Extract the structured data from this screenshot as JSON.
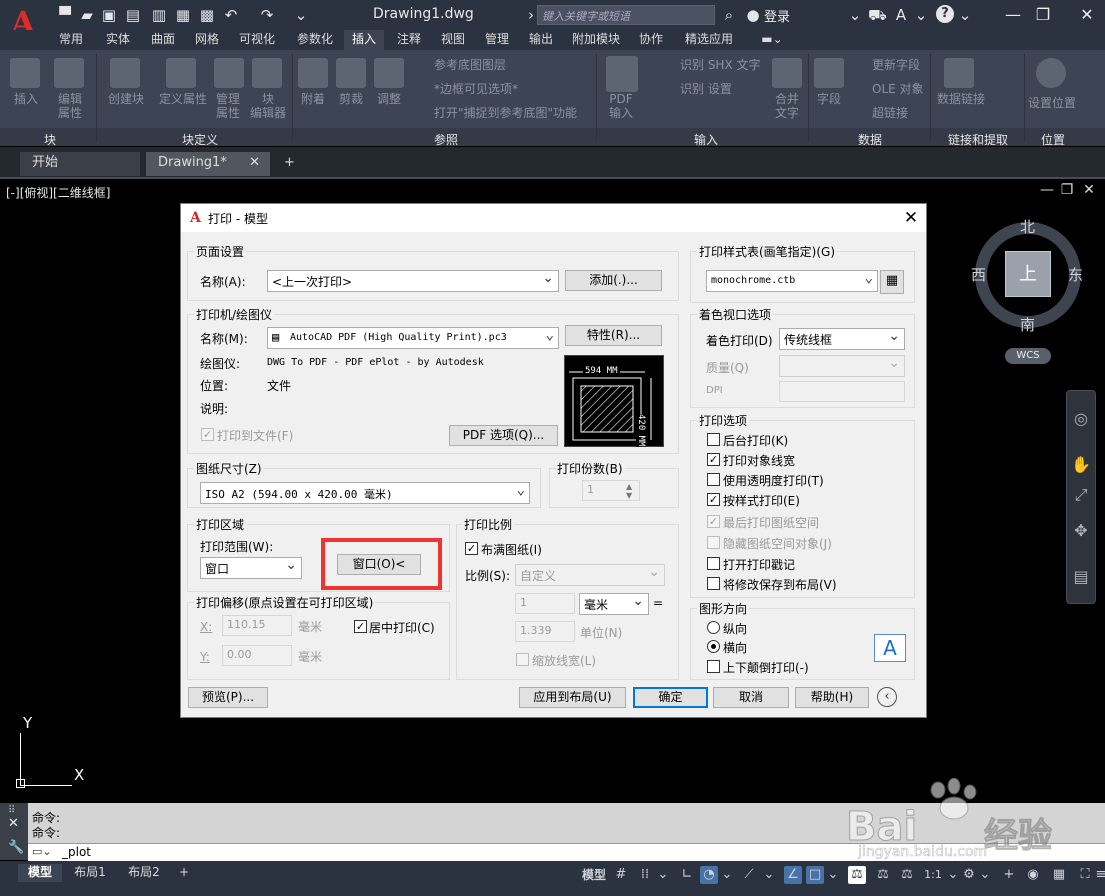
{
  "titlebar": {
    "doc_title": "Drawing1.dwg",
    "search_placeholder": "键入关键字或短语",
    "login": "登录",
    "help_icon": "?"
  },
  "ribbon_tabs": [
    "常用",
    "实体",
    "曲面",
    "网格",
    "可视化",
    "参数化",
    "插入",
    "注释",
    "视图",
    "管理",
    "输出",
    "附加模块",
    "协作",
    "精选应用"
  ],
  "ribbon": {
    "panel_titles": [
      "块",
      "块定义",
      "参照",
      "输入",
      "数据",
      "链接和提取",
      "位置"
    ],
    "block": [
      "插入",
      "编辑\n属性"
    ],
    "block_def": [
      "创建块",
      "定义属性",
      "管理\n属性",
      "块\n编辑器"
    ],
    "reference": [
      "附着",
      "剪裁",
      "调整",
      "参考底图图层",
      "*边框可见选项*",
      "打开\"捕捉到参考底图\"功能"
    ],
    "import": [
      "PDF\n输入",
      "识别 SHX 文字",
      "识别 设置",
      "合并\n文字"
    ],
    "data": [
      "字段",
      "更新字段",
      "OLE 对象",
      "超链接"
    ],
    "link": [
      "数据链接"
    ],
    "location": [
      "设置位置"
    ]
  },
  "file_tabs": [
    "开始",
    "Drawing1*"
  ],
  "viewport": {
    "label": "[-][俯视][二维线框]",
    "cube_top": "上",
    "north": "北",
    "south": "南",
    "east": "东",
    "west": "西",
    "wcs": "WCS",
    "ucs_x": "X",
    "ucs_y": "Y"
  },
  "dialog": {
    "title": "打印 - 模型",
    "page_setup": {
      "group": "页面设置",
      "name_label": "名称(A):",
      "name_value": "<上一次打印>",
      "add_button": "添加(.)..."
    },
    "printer": {
      "group": "打印机/绘图仪",
      "name_label": "名称(M):",
      "name_value": "AutoCAD PDF (High Quality Print).pc3",
      "properties_button": "特性(R)...",
      "plotter_label": "绘图仪:",
      "plotter_value": "DWG To PDF - PDF ePlot - by Autodesk",
      "location_label": "位置:",
      "location_value": "文件",
      "desc_label": "说明:",
      "plot_to_file": "打印到文件(F)",
      "pdf_options_button": "PDF 选项(Q)...",
      "preview_width": "594 MM",
      "preview_height": "420 MM"
    },
    "paper_size": {
      "group": "图纸尺寸(Z)",
      "value": "ISO A2 (594.00 x 420.00 毫米)"
    },
    "copies": {
      "group": "打印份数(B)",
      "value": "1"
    },
    "plot_area": {
      "group": "打印区域",
      "range_label": "打印范围(W):",
      "range_value": "窗口",
      "window_button": "窗口(O)<"
    },
    "plot_offset": {
      "group": "打印偏移(原点设置在可打印区域)",
      "x_label": "X:",
      "x_value": "110.15",
      "y_label": "Y:",
      "y_value": "0.00",
      "unit": "毫米",
      "center": "居中打印(C)"
    },
    "plot_scale": {
      "group": "打印比例",
      "fit": "布满图纸(I)",
      "scale_label": "比例(S):",
      "scale_value": "自定义",
      "v1": "1",
      "unit": "毫米",
      "eq": "=",
      "v2": "1.339",
      "unit2": "单位(N)",
      "scale_lw": "缩放线宽(L)"
    },
    "style_table": {
      "group": "打印样式表(画笔指定)(G)",
      "value": "monochrome.ctb"
    },
    "shaded": {
      "group": "着色视口选项",
      "shade_label": "着色打印(D)",
      "shade_value": "传统线框",
      "quality_label": "质量(Q)",
      "dpi_label": "DPI"
    },
    "options": {
      "group": "打印选项",
      "items": [
        {
          "label": "后台打印(K)",
          "checked": false,
          "enabled": true
        },
        {
          "label": "打印对象线宽",
          "checked": true,
          "enabled": true
        },
        {
          "label": "使用透明度打印(T)",
          "checked": false,
          "enabled": true
        },
        {
          "label": "按样式打印(E)",
          "checked": true,
          "enabled": true
        },
        {
          "label": "最后打印图纸空间",
          "checked": true,
          "enabled": false
        },
        {
          "label": "隐藏图纸空间对象(J)",
          "checked": false,
          "enabled": false
        },
        {
          "label": "打开打印戳记",
          "checked": false,
          "enabled": true
        },
        {
          "label": "将修改保存到布局(V)",
          "checked": false,
          "enabled": true
        }
      ]
    },
    "orientation": {
      "group": "图形方向",
      "portrait": "纵向",
      "landscape": "横向",
      "upside": "上下颠倒打印(-)"
    },
    "footer": {
      "preview": "预览(P)...",
      "apply": "应用到布局(U)",
      "ok": "确定",
      "cancel": "取消",
      "help": "帮助(H)"
    }
  },
  "command": {
    "line1": "命令:",
    "line2": "命令:",
    "input": "_plot"
  },
  "status": {
    "layout_tabs": [
      "模型",
      "布局1",
      "布局2"
    ],
    "scale": "1:1"
  },
  "watermark": {
    "brand": "Bai",
    "brand2": "经验",
    "url": "jingyan.baidu.com"
  },
  "colors": {
    "accent_red": "#ee3330",
    "ribbon_bg": "#3d4453",
    "dialog_bg": "#f0f0f0"
  }
}
